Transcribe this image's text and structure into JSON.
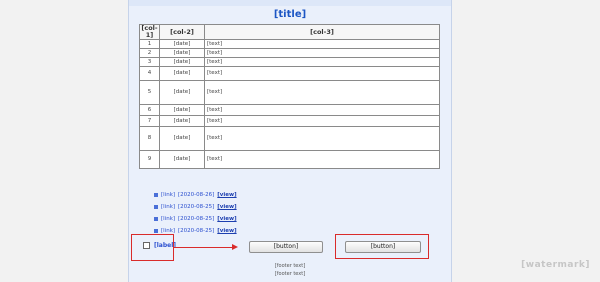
{
  "schedule": {
    "title": "[title]",
    "columns": [
      "[col-1]",
      "[col-2]",
      "[col-3]"
    ],
    "rows": [
      {
        "no": "1",
        "time": "[date]",
        "content": "[text]"
      },
      {
        "no": "2",
        "time": "[date]",
        "content": "[text]"
      },
      {
        "no": "3",
        "time": "[date]",
        "content": "[text]"
      },
      {
        "no": "4",
        "time": "[date]",
        "content": "[text]"
      },
      {
        "no": "5",
        "time": "[date]",
        "content": "[text]"
      },
      {
        "no": "6",
        "time": "[date]",
        "content": "[text]"
      },
      {
        "no": "7",
        "time": "[date]",
        "content": "[text]"
      },
      {
        "no": "8",
        "time": "[date]",
        "content": "[text]"
      },
      {
        "no": "9",
        "time": "[date]",
        "content": "[text]"
      }
    ]
  },
  "notices": [
    {
      "title": "[link]",
      "date": "[2020-08-26]",
      "action": "[view]"
    },
    {
      "title": "[link]",
      "date": "[2020-08-25]",
      "action": "[view]"
    },
    {
      "title": "[link]",
      "date": "[2020-08-25]",
      "action": "[view]"
    },
    {
      "title": "[link]",
      "date": "[2020-08-25]",
      "action": "[view]"
    }
  ],
  "controls": {
    "checkbox_label": "[label]",
    "button_assist": "[button]",
    "button_fill": "[button]"
  },
  "footer": {
    "line1": "[footer text]",
    "line2": "[footer text]"
  },
  "watermark": "[watermark]",
  "colors": {
    "accent": "#1d56c4",
    "link": "#2b4fcf",
    "highlight": "#d92b2b"
  }
}
